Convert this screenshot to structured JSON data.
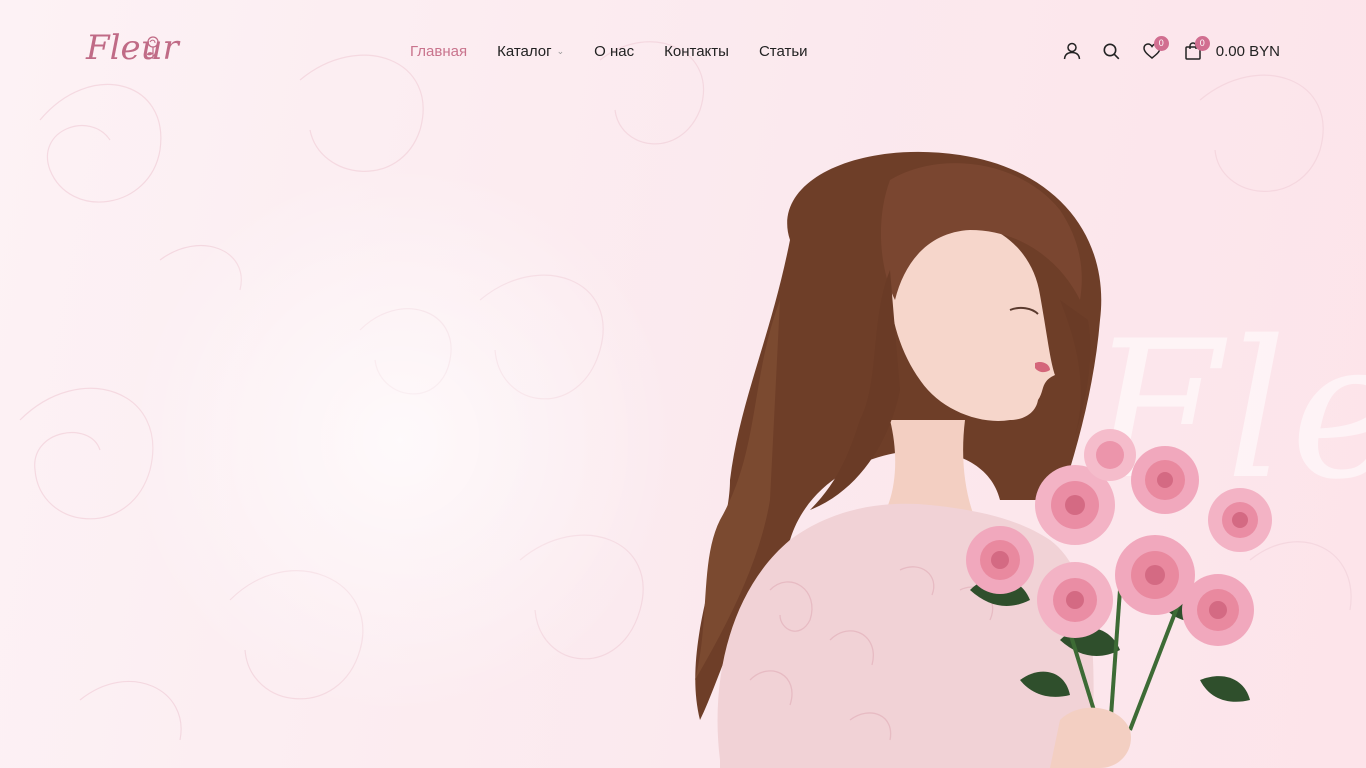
{
  "brand": {
    "logo_text": "Fleur"
  },
  "nav": {
    "items": [
      {
        "label": "Главная",
        "active": true
      },
      {
        "label": "Каталог",
        "has_dropdown": true
      },
      {
        "label": "О нас"
      },
      {
        "label": "Контакты"
      },
      {
        "label": "Статьи"
      }
    ]
  },
  "actions": {
    "account_icon": "user-icon",
    "search_icon": "search-icon",
    "wishlist_icon": "heart-icon",
    "wishlist_count": "0",
    "cart_icon": "shopping-bag-icon",
    "cart_count": "0",
    "cart_total": "0.00 BYN"
  },
  "hero": {
    "watermark_text": "Fleur",
    "image_description": "woman-with-pink-roses"
  },
  "colors": {
    "accent": "#c9748d",
    "badge": "#d16e90",
    "background": "#fbe9ee",
    "text": "#222222"
  }
}
